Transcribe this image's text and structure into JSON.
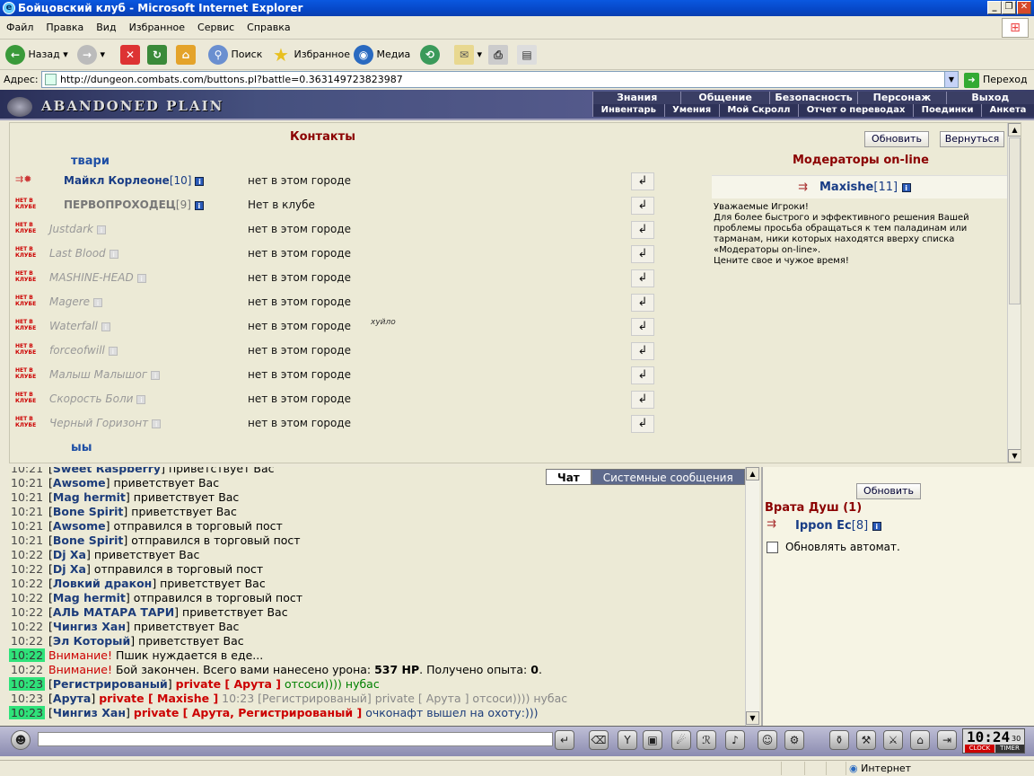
{
  "window": {
    "title": "Бойцовский клуб - Microsoft Internet Explorer"
  },
  "menu": [
    "Файл",
    "Правка",
    "Вид",
    "Избранное",
    "Сервис",
    "Справка"
  ],
  "toolbar": {
    "back": "Назад",
    "search": "Поиск",
    "favorites": "Избранное",
    "media": "Медиа"
  },
  "address": {
    "label": "Адрес:",
    "url": "http://dungeon.combats.com/buttons.pl?battle=0.363149723823987",
    "go": "Переход"
  },
  "game": {
    "location_name": "ABANDONED PLAIN",
    "nav_top": [
      "Знания",
      "Общение",
      "Безопасность",
      "Персонаж",
      "Выход"
    ],
    "nav_bottom": [
      "Инвентарь",
      "Умения",
      "Мой Скролл",
      "Отчет о переводах",
      "Поединки",
      "Анкета"
    ]
  },
  "contacts": {
    "title": "Контакты",
    "refresh": "Обновить",
    "back": "Вернуться",
    "group1": "твари",
    "group2": "ыы",
    "rows": [
      {
        "name": "Майкл Корлеоне",
        "level": "[10]",
        "location": "нет в этом городе",
        "online": true,
        "note": ""
      },
      {
        "name": "ПЕРВОПРОХОДЕЦ",
        "level": "[9]",
        "location": "Нет в клубе",
        "online": true,
        "note": ""
      },
      {
        "name": "Justdark",
        "level": "",
        "location": "нет в этом городе",
        "online": false,
        "note": ""
      },
      {
        "name": "Last Blood",
        "level": "",
        "location": "нет в этом городе",
        "online": false,
        "note": ""
      },
      {
        "name": "MASHINE-HEAD",
        "level": "",
        "location": "нет в этом городе",
        "online": false,
        "note": ""
      },
      {
        "name": "Magere",
        "level": "",
        "location": "нет в этом городе",
        "online": false,
        "note": ""
      },
      {
        "name": "Waterfall",
        "level": "",
        "location": "нет в этом городе",
        "online": false,
        "note": "хуйло"
      },
      {
        "name": "forceofwill",
        "level": "",
        "location": "нет в этом городе",
        "online": false,
        "note": ""
      },
      {
        "name": "Малыш Малышог",
        "level": "",
        "location": "нет в этом городе",
        "online": false,
        "note": ""
      },
      {
        "name": "Скорость Боли",
        "level": "",
        "location": "нет в этом городе",
        "online": false,
        "note": ""
      },
      {
        "name": "Черный Горизонт",
        "level": "",
        "location": "нет в этом городе",
        "online": false,
        "note": ""
      }
    ],
    "badge_text": "НЕТ В КЛУБЕ",
    "moderators_title": "Модераторы on-line",
    "moderator": {
      "name": "Maxishe",
      "level": "[11]"
    },
    "moderator_text": [
      "Уважаемые Игроки!",
      "Для более быстрого и эффективного решения Вашей",
      "проблемы просьба обращаться к тем паладинам или",
      "тарманам, ники которых находятся вверху списка",
      "«Модераторы on-line».",
      "Цените свое и чужое время!"
    ]
  },
  "chat": {
    "tabs": [
      "Чат",
      "Системные сообщения"
    ],
    "lines": [
      {
        "time": "10:21",
        "name": "Sweet Raspberry",
        "text": " приветствует Вас"
      },
      {
        "time": "10:21",
        "name": "Awsome",
        "text": " приветствует Вас"
      },
      {
        "time": "10:21",
        "name": "Mag hermit",
        "text": " приветствует Вас"
      },
      {
        "time": "10:21",
        "name": "Bone Spirit",
        "text": " приветствует Вас"
      },
      {
        "time": "10:21",
        "name": "Awsome",
        "text": " отправился в торговый пост"
      },
      {
        "time": "10:21",
        "name": "Bone Spirit",
        "text": " отправился в торговый пост"
      },
      {
        "time": "10:22",
        "name": "Dj Xa",
        "text": " приветствует Вас"
      },
      {
        "time": "10:22",
        "name": "Dj Xa",
        "text": " отправился в торговый пост"
      },
      {
        "time": "10:22",
        "name": "Ловкий дракон",
        "text": " приветствует Вас"
      },
      {
        "time": "10:22",
        "name": "Mag hermit",
        "text": " отправился в торговый пост"
      },
      {
        "time": "10:22",
        "name": "АЛЬ МАТАРА ТАРИ",
        "text": " приветствует Вас"
      },
      {
        "time": "10:22",
        "name": "Чингиз Хан",
        "text": " приветствует Вас"
      },
      {
        "time": "10:22",
        "name": "Эл Который",
        "text": " приветствует Вас"
      }
    ],
    "sys1": {
      "time": "10:22",
      "label": "Внимание!",
      "text": " Пшик нуждается в еде..."
    },
    "sys2": {
      "time": "10:22",
      "label": "Внимание!",
      "text": " Бой закончен. Всего вами нанесено урона: ",
      "dmg": "537 HP",
      "text2": ". Получено опыта: ",
      "exp": "0",
      "text3": "."
    },
    "p1": {
      "time": "10:23",
      "name": "Регистрированый",
      "priv": "private [ Арута ]",
      "msg": " отсоси)))) нубас"
    },
    "p2": {
      "time": "10:23",
      "name": "Арута",
      "priv": "private [ Maxishe ]",
      "echo": " 10:23 [Регистрированый] private [ Арута ] отсоси)))) нубас"
    },
    "p3": {
      "time": "10:23",
      "name": "Чингиз Хан",
      "priv": "private [ Арута, Регистрированый ]",
      "msg": " очконафт вышел на охоту:)))"
    }
  },
  "location_pane": {
    "refresh": "Обновить",
    "title": "Врата Душ (1)",
    "user": {
      "name": "Ippon Ec",
      "level": "[8]"
    },
    "auto_refresh": "Обновлять автомат."
  },
  "clock": {
    "time": "10:24",
    "sec": "30",
    "clock_label": "CLOCK",
    "timer_label": "TIMER"
  },
  "status": {
    "zone": "Интернет"
  }
}
